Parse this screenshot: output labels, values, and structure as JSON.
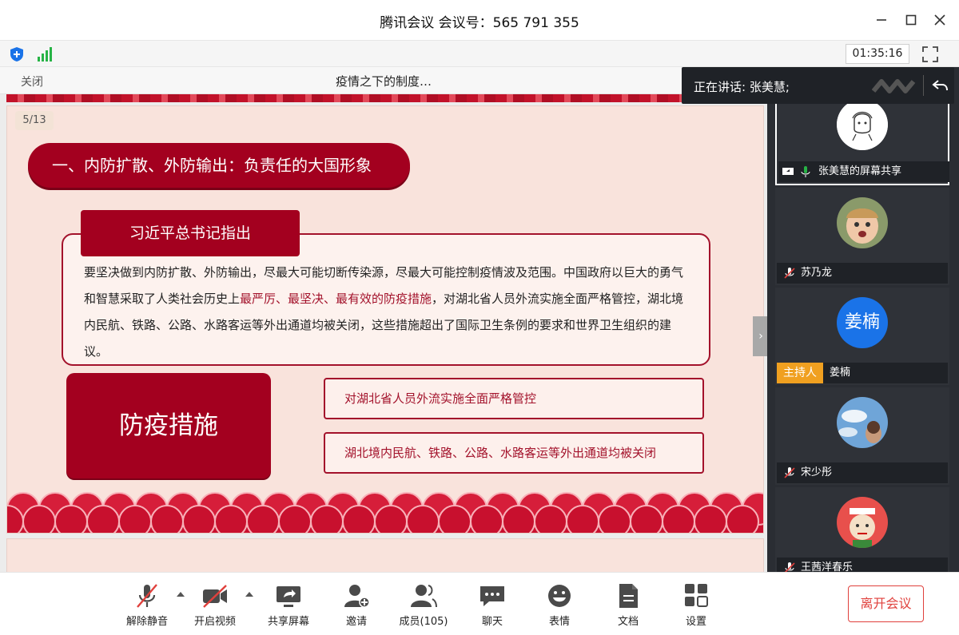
{
  "window": {
    "title": "腾讯会议 会议号：565 791 355",
    "timer": "01:35:16"
  },
  "doc": {
    "close_label": "关闭",
    "title": "疫情之下的制度…"
  },
  "slide": {
    "page": "5/13",
    "heading": "一、内防扩散、外防输出：负责任的大国形象",
    "quote_title": "习近平总书记指出",
    "quote_part1": "要坚决做到内防扩散、外防输出，尽最大可能切断传染源，尽最大可能控制疫情波及范围。中国政府以巨大的勇气和智慧采取了人类社会历史上",
    "quote_highlight": "最严厉、最坚决、最有效的防疫措施",
    "quote_part2": "，对湖北省人员外流实施全面严格管控，湖北境内民航、铁路、公路、水路客运等外出通道均被关闭，这些措施超出了国际卫生条例的要求和世界卫生组织的建议。",
    "measures_title": "防疫措施",
    "measure_1": "对湖北省人员外流实施全面严格管控",
    "measure_2": "湖北境内民航、铁路、公路、水路客运等外出通道均被关闭"
  },
  "speaking": {
    "text": "正在讲话: 张美慧;"
  },
  "participants": [
    {
      "name": "张美慧的屏幕共享",
      "avatar": "sketch-avatar",
      "active": true
    },
    {
      "name": "苏乃龙",
      "avatar": "child-photo"
    },
    {
      "name": "姜楠",
      "avatar_text": "姜楠",
      "badge": "主持人"
    },
    {
      "name": "宋少彤",
      "avatar": "sky-photo"
    },
    {
      "name": "王茜洋春乐",
      "avatar": "cartoon-avatar"
    }
  ],
  "toolbar": {
    "unmute": "解除静音",
    "video": "开启视频",
    "share": "共享屏幕",
    "invite": "邀请",
    "members": "成员(105)",
    "chat": "聊天",
    "emoji": "表情",
    "docs": "文档",
    "settings": "设置",
    "leave": "离开会议"
  },
  "colors": {
    "slide_red": "#a3001f",
    "slide_bg": "#f9e3dc",
    "leave_red": "#e0403c",
    "host_badge": "#f0a020",
    "avatar_blue": "#1a73e8"
  }
}
